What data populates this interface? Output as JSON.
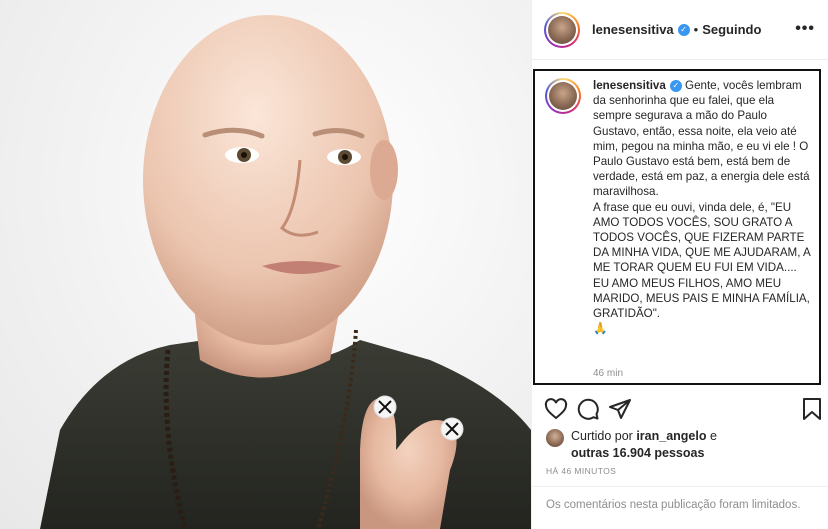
{
  "post": {
    "author": {
      "username": "lenesensitiva",
      "verified_icon": "verified-badge-icon",
      "follow_status": "Seguindo",
      "separator": "•",
      "more_options": "•••"
    },
    "caption": {
      "username": "lenesensitiva",
      "text": " Gente, vocês lembram da senhorinha que eu falei, que ela sempre segurava a mão do Paulo Gustavo, então, essa noite, ela veio até mim, pegou na minha mão, e eu vi ele ! O Paulo Gustavo está bem, está bem de verdade, está em paz, a energia dele está maravilhosa.\nA frase que eu ouvi, vinda dele, é, \"EU AMO TODOS VOCÊS, SOU GRATO A TODOS VOCÊS, QUE FIZERAM PARTE DA MINHA VIDA, QUE ME AJUDARAM, A ME TORAR QUEM EU FUI EM VIDA.... EU AMO MEUS FILHOS, AMO MEU MARIDO, MEUS PAIS E MINHA FAMÍLIA, GRATIDÃO\".\n🙏",
      "time": "46 min"
    },
    "actions": {
      "like_icon": "heart-icon",
      "comment_icon": "comment-icon",
      "share_icon": "share-icon",
      "save_icon": "bookmark-icon"
    },
    "likes": {
      "prefix": "Curtido por ",
      "user": "iran_angelo",
      "middle": " e ",
      "others": "outras 16.904 pessoas"
    },
    "posted_ago": "HÁ 46 MINUTOS",
    "comments_notice": "Os comentários nesta publicação foram limitados."
  },
  "colors": {
    "accent_blue": "#3897f0",
    "muted": "#8e8e8e",
    "text": "#262626",
    "border": "#efefef"
  }
}
